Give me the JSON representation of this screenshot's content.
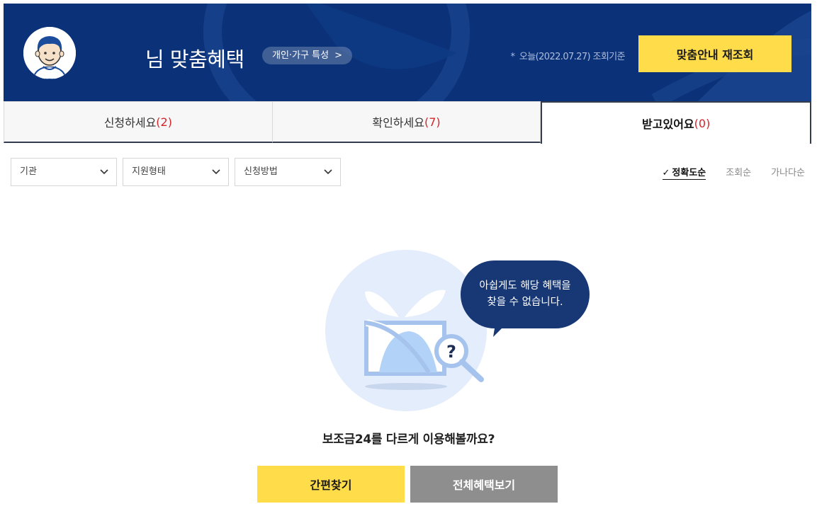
{
  "header": {
    "title": "님 맞춤혜택",
    "trait_link": "개인·가구 특성",
    "trait_chevron": ">",
    "as_of_star": "*",
    "as_of": "오늘(2022.07.27) 조회기준",
    "requery_button": "맞춤안내 재조회",
    "colors": {
      "banner": "#0b3278",
      "accent": "#ffdc4a"
    }
  },
  "tabs": [
    {
      "label": "신청하세요",
      "count": "(2)"
    },
    {
      "label": "확인하세요",
      "count": "(7)"
    },
    {
      "label": "받고있어요",
      "count": "(0)",
      "active": true
    }
  ],
  "filters": [
    {
      "label": "기관"
    },
    {
      "label": "지원형태"
    },
    {
      "label": "신청방법"
    }
  ],
  "sort": {
    "check": "✓",
    "options": [
      "정확도순",
      "조회순",
      "가나다순"
    ],
    "active": "정확도순"
  },
  "empty_state": {
    "bubble_line1": "아쉽게도 해당 혜택을",
    "bubble_line2": "찾을 수 없습니다.",
    "question_mark": "?",
    "prompt": "보조금24를 다르게 이용해볼까요?",
    "quick_button": "간편찾기",
    "all_button": "전체혜택보기"
  }
}
